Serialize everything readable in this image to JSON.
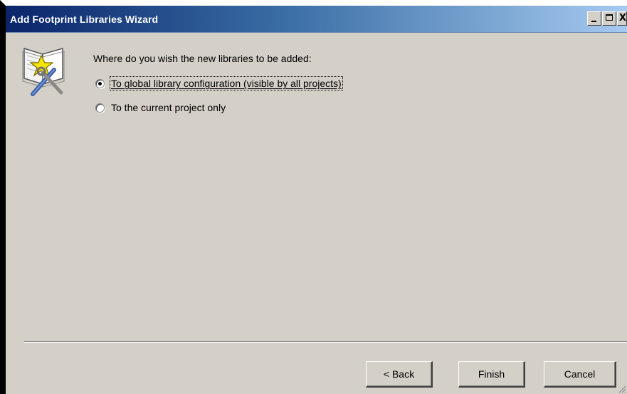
{
  "window": {
    "title": "Add Footprint Libraries Wizard",
    "controls": {
      "minimize_label": "_",
      "maximize_label": "□",
      "close_label": "X"
    }
  },
  "wizard_icon": "wizard-book-tools-icon",
  "page": {
    "prompt": "Where do you wish the new libraries to be added:",
    "options": [
      {
        "label": "To global library configuration (visible by all projects)",
        "selected": true
      },
      {
        "label": "To the current project only",
        "selected": false
      }
    ]
  },
  "buttons": {
    "back": "< Back",
    "finish": "Finish",
    "cancel": "Cancel"
  },
  "colors": {
    "title_start": "#0a246a",
    "title_end": "#a6caf0",
    "face": "#d4d0c8"
  }
}
